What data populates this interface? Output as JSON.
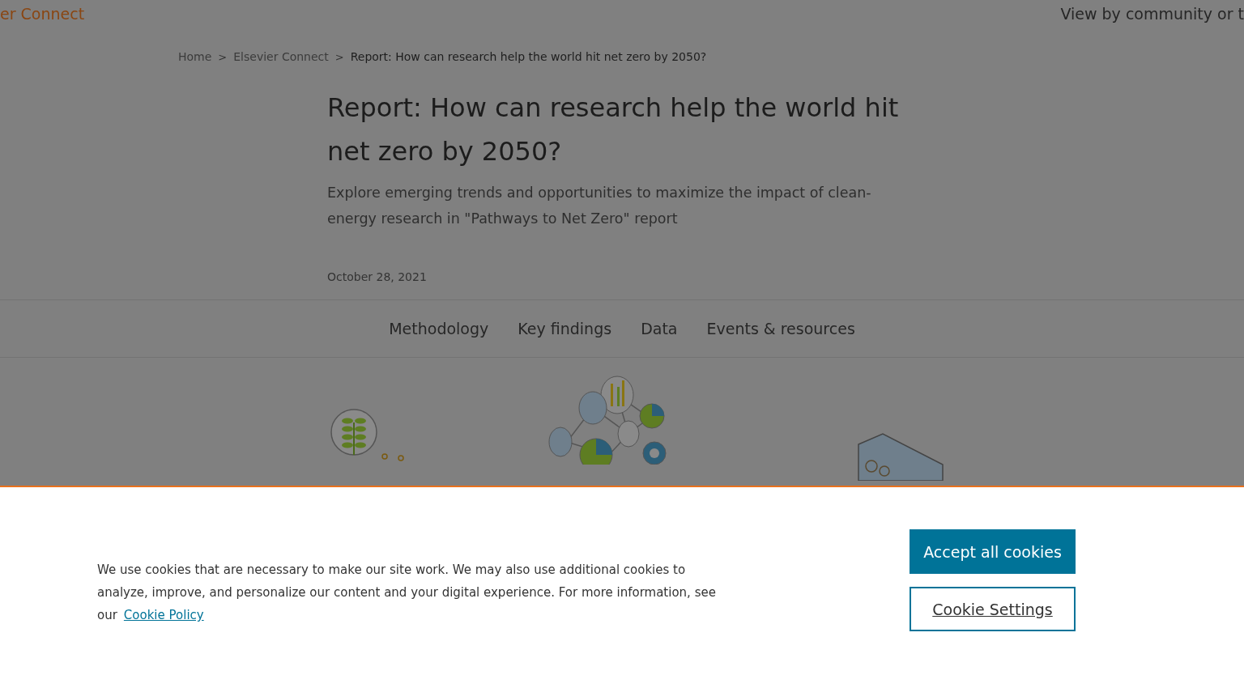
{
  "header": {
    "site_link": "er Connect",
    "topic_link": "View by community or t"
  },
  "breadcrumb": [
    {
      "label": "Home",
      "separator": ">"
    },
    {
      "label": "Elsevier Connect",
      "separator": ">"
    },
    {
      "label": "Report: How can research help the world hit net zero by 2050?"
    }
  ],
  "article": {
    "title": "Report: How can research help the world hit net zero by 2050?",
    "subtitle": "Explore emerging trends and opportunities to maximize the impact of clean-energy research in \"Pathways to Net Zero\" report",
    "date": "October 28, 2021"
  },
  "section_nav": [
    "Methodology",
    "Key findings",
    "Data",
    "Events & resources"
  ],
  "cookie_banner": {
    "text": "We use cookies that are necessary to make our site work. We may also use additional cookies to analyze, improve, and personalize our content and your digital experience. For more information, see our",
    "link": "Cookie Policy",
    "buttons": [
      {
        "label": "Accept all cookies",
        "kind": "primary"
      },
      {
        "label": "Cookie Settings",
        "kind": "outline"
      }
    ]
  }
}
